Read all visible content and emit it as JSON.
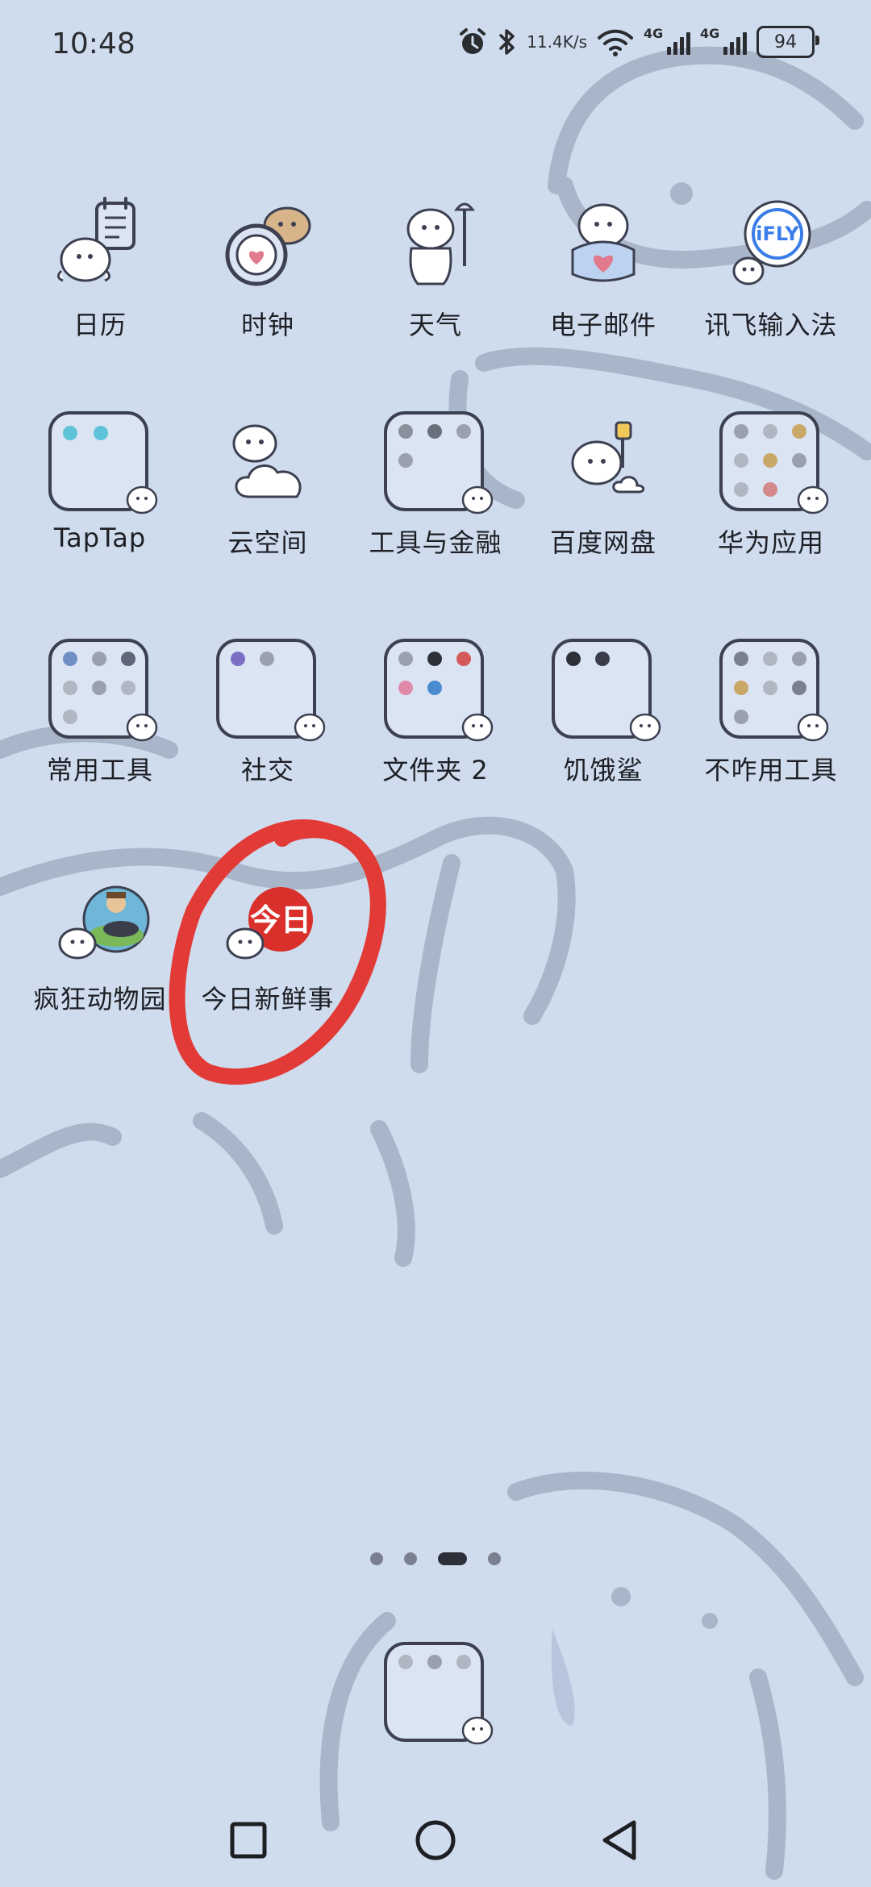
{
  "status_bar": {
    "time": "10:48",
    "net_speed_value": "11.4",
    "net_speed_unit": "K/s",
    "signal1_label": "4G",
    "signal2_label": "4G",
    "battery": "94",
    "icons": [
      "alarm-icon",
      "bluetooth-icon",
      "wifi-icon",
      "signal-icon",
      "battery-icon"
    ]
  },
  "apps": [
    {
      "label": "日历",
      "icon": "calendar-icon"
    },
    {
      "label": "时钟",
      "icon": "clock-icon"
    },
    {
      "label": "天气",
      "icon": "weather-icon"
    },
    {
      "label": "电子邮件",
      "icon": "email-icon"
    },
    {
      "label": "讯飞输入法",
      "icon": "iflytek-icon"
    },
    {
      "label": "TapTap",
      "icon": "folder-icon"
    },
    {
      "label": "云空间",
      "icon": "cloud-icon"
    },
    {
      "label": "工具与金融",
      "icon": "folder-icon"
    },
    {
      "label": "百度网盘",
      "icon": "baidu-netdisk-icon"
    },
    {
      "label": "华为应用",
      "icon": "folder-icon"
    },
    {
      "label": "常用工具",
      "icon": "folder-icon"
    },
    {
      "label": "社交",
      "icon": "folder-icon"
    },
    {
      "label": "文件夹 2",
      "icon": "folder-icon"
    },
    {
      "label": "饥饿鲨",
      "icon": "folder-icon"
    },
    {
      "label": "不咋用工具",
      "icon": "folder-icon"
    },
    {
      "label": "疯狂动物园",
      "icon": "crazy-zoo-icon"
    },
    {
      "label": "今日新鲜事",
      "icon": "today-news-icon"
    }
  ],
  "today_icon_text": "今日",
  "iflytek_icon_text": "iFLY",
  "page_indicator": {
    "count": 4,
    "active": 3
  },
  "dock": {
    "label": "",
    "icon": "folder-icon"
  },
  "annotation": {
    "color": "#e23a36"
  },
  "colors": {
    "wallpaper": "#cfdcee",
    "line": "#a9b6c9",
    "icon_stroke": "#3c4050"
  },
  "navbar": {
    "buttons": [
      "recents-button",
      "home-button",
      "back-button"
    ]
  }
}
